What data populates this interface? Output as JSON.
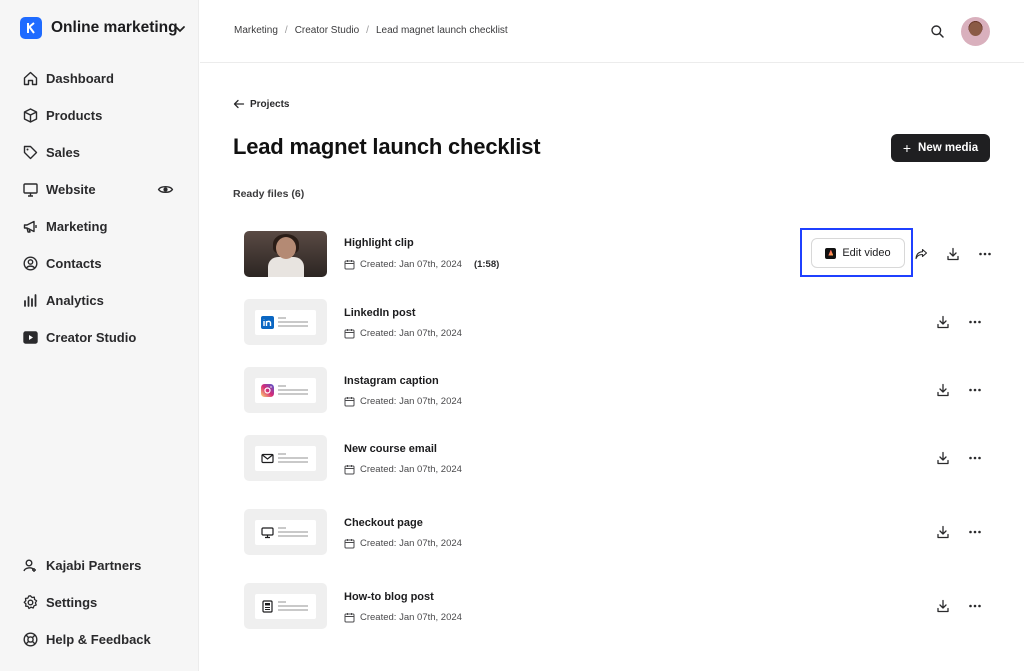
{
  "sidebar": {
    "workspace": "Online marketing",
    "items": [
      {
        "label": "Dashboard",
        "icon": "home-icon"
      },
      {
        "label": "Products",
        "icon": "box-icon"
      },
      {
        "label": "Sales",
        "icon": "tag-icon"
      },
      {
        "label": "Website",
        "icon": "monitor-icon"
      },
      {
        "label": "Marketing",
        "icon": "megaphone-icon"
      },
      {
        "label": "Contacts",
        "icon": "contact-icon"
      },
      {
        "label": "Analytics",
        "icon": "bar-chart-icon"
      },
      {
        "label": "Creator Studio",
        "icon": "video-icon"
      }
    ],
    "bottom_items": [
      {
        "label": "Kajabi Partners",
        "icon": "partner-icon"
      },
      {
        "label": "Settings",
        "icon": "gear-icon"
      },
      {
        "label": "Help & Feedback",
        "icon": "help-icon"
      }
    ]
  },
  "header": {
    "breadcrumb": [
      "Marketing",
      "Creator Studio",
      "Lead magnet launch checklist"
    ]
  },
  "main": {
    "back_label": "Projects",
    "title": "Lead magnet launch checklist",
    "new_media_label": "New media",
    "section_label": "Ready files (6)",
    "files": [
      {
        "name": "Highlight clip",
        "created": "Created: Jan 07th, 2024",
        "duration": "(1:58)",
        "type": "video"
      },
      {
        "name": "LinkedIn post",
        "created": "Created: Jan 07th, 2024",
        "type": "linkedin"
      },
      {
        "name": "Instagram caption",
        "created": "Created: Jan 07th, 2024",
        "type": "instagram"
      },
      {
        "name": "New course email",
        "created": "Created: Jan 07th, 2024",
        "type": "email"
      },
      {
        "name": "Checkout page",
        "created": "Created: Jan 07th, 2024",
        "type": "checkout"
      },
      {
        "name": "How-to blog post",
        "created": "Created: Jan 07th, 2024",
        "type": "blog"
      }
    ],
    "edit_video_label": "Edit video"
  },
  "colors": {
    "brand": "#1f6bff",
    "highlight_border": "#1f40ff",
    "primary_button": "#1f1f21"
  }
}
